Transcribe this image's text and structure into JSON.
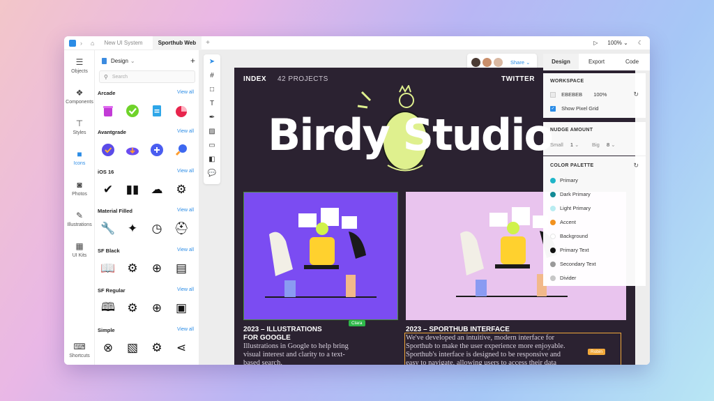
{
  "titlebar": {
    "tabs": [
      "New UI System",
      "Sporthub Web"
    ],
    "active_tab": "Sporthub Web",
    "zoom": "100%"
  },
  "rail": [
    {
      "label": "Objects",
      "icon": "database-icon"
    },
    {
      "label": "Components",
      "icon": "components-icon"
    },
    {
      "label": "Styles",
      "icon": "paint-roller-icon"
    },
    {
      "label": "Icons",
      "icon": "icons-grid-icon"
    },
    {
      "label": "Photos",
      "icon": "camera-icon"
    },
    {
      "label": "Illustrations",
      "icon": "pen-icon"
    },
    {
      "label": "UI Kits",
      "icon": "grid-icon"
    },
    {
      "label": "Shortcuts",
      "icon": "keyboard-icon"
    }
  ],
  "panel": {
    "title": "Design",
    "search_placeholder": "Search",
    "view_all": "View all",
    "sections": [
      "Arcade",
      "Avantgrade",
      "iOS 16",
      "Material Filled",
      "SF Black",
      "SF Regular",
      "Simple"
    ]
  },
  "artboard": {
    "nav_index": "INDEX",
    "nav_projects": "42 PROJECTS",
    "nav_twitter": "TWITTER",
    "logo_text": "Birdy Studio",
    "card1_title_line1": "2023 – ILLUSTRATIONS",
    "card1_title_line2": "FOR GOOGLE",
    "card1_desc_1": "Illustrations in Google to help bring",
    "card1_desc_2": "visual interest and clarity to a text-",
    "card1_desc_3": "based search.",
    "card2_title": "2023 – SPORTHUB INTERFACE",
    "card2_desc_1": "We've developed an intuitive, modern interface for",
    "card2_desc_2": "Sporthub to make the user experience more enjoyable.",
    "card2_desc_3": "Sporthub's interface is designed to be responsive and",
    "card2_desc_4": "easy to navigate, allowing users to access their data",
    "cursor_clara": "Clara",
    "cursor_robin": "Robin"
  },
  "share": {
    "label": "Share"
  },
  "inspector": {
    "tabs": [
      "Design",
      "Export",
      "Code"
    ],
    "workspace_title": "WORKSPACE",
    "workspace_color": "EBEBEB",
    "workspace_opacity": "100%",
    "pixel_grid_label": "Show Pixel Grid",
    "nudge_title": "NUDGE AMOUNT",
    "small_label": "Small",
    "small_value": "1",
    "big_label": "Big",
    "big_value": "8",
    "palette_title": "COLOR PALETTE",
    "palette": [
      {
        "name": "Primary",
        "color": "#1fb5c8"
      },
      {
        "name": "Dark Primary",
        "color": "#138a96"
      },
      {
        "name": "Light Primary",
        "color": "#b9ecf1"
      },
      {
        "name": "Accent",
        "color": "#f2921f"
      },
      {
        "name": "Background",
        "color": "#ffffff"
      },
      {
        "name": "Primary Text",
        "color": "#111111"
      },
      {
        "name": "Secondary Text",
        "color": "#9a9a9a"
      },
      {
        "name": "Divider",
        "color": "#c7c7c7"
      }
    ]
  }
}
